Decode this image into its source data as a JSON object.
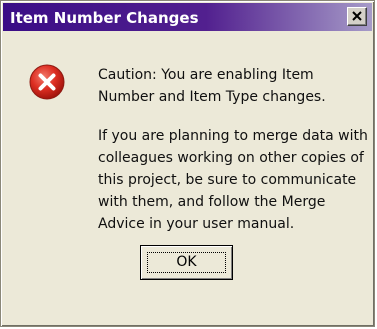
{
  "window": {
    "title": "Item Number Changes",
    "close_icon": "close-x-icon"
  },
  "icon": {
    "name": "error-icon",
    "color": "#d8271e"
  },
  "message": {
    "line1": "Caution:  You are enabling Item Number and Item Type changes.",
    "line2": "If you are planning to merge data with colleagues working on other copies of this project, be sure to communicate with them, and follow the Merge Advice in your user manual."
  },
  "buttons": {
    "ok_label": "OK"
  },
  "colors": {
    "titlebar_start": "#3a0d86",
    "titlebar_end": "#a69bc8",
    "dialog_bg": "#ece9d8"
  }
}
